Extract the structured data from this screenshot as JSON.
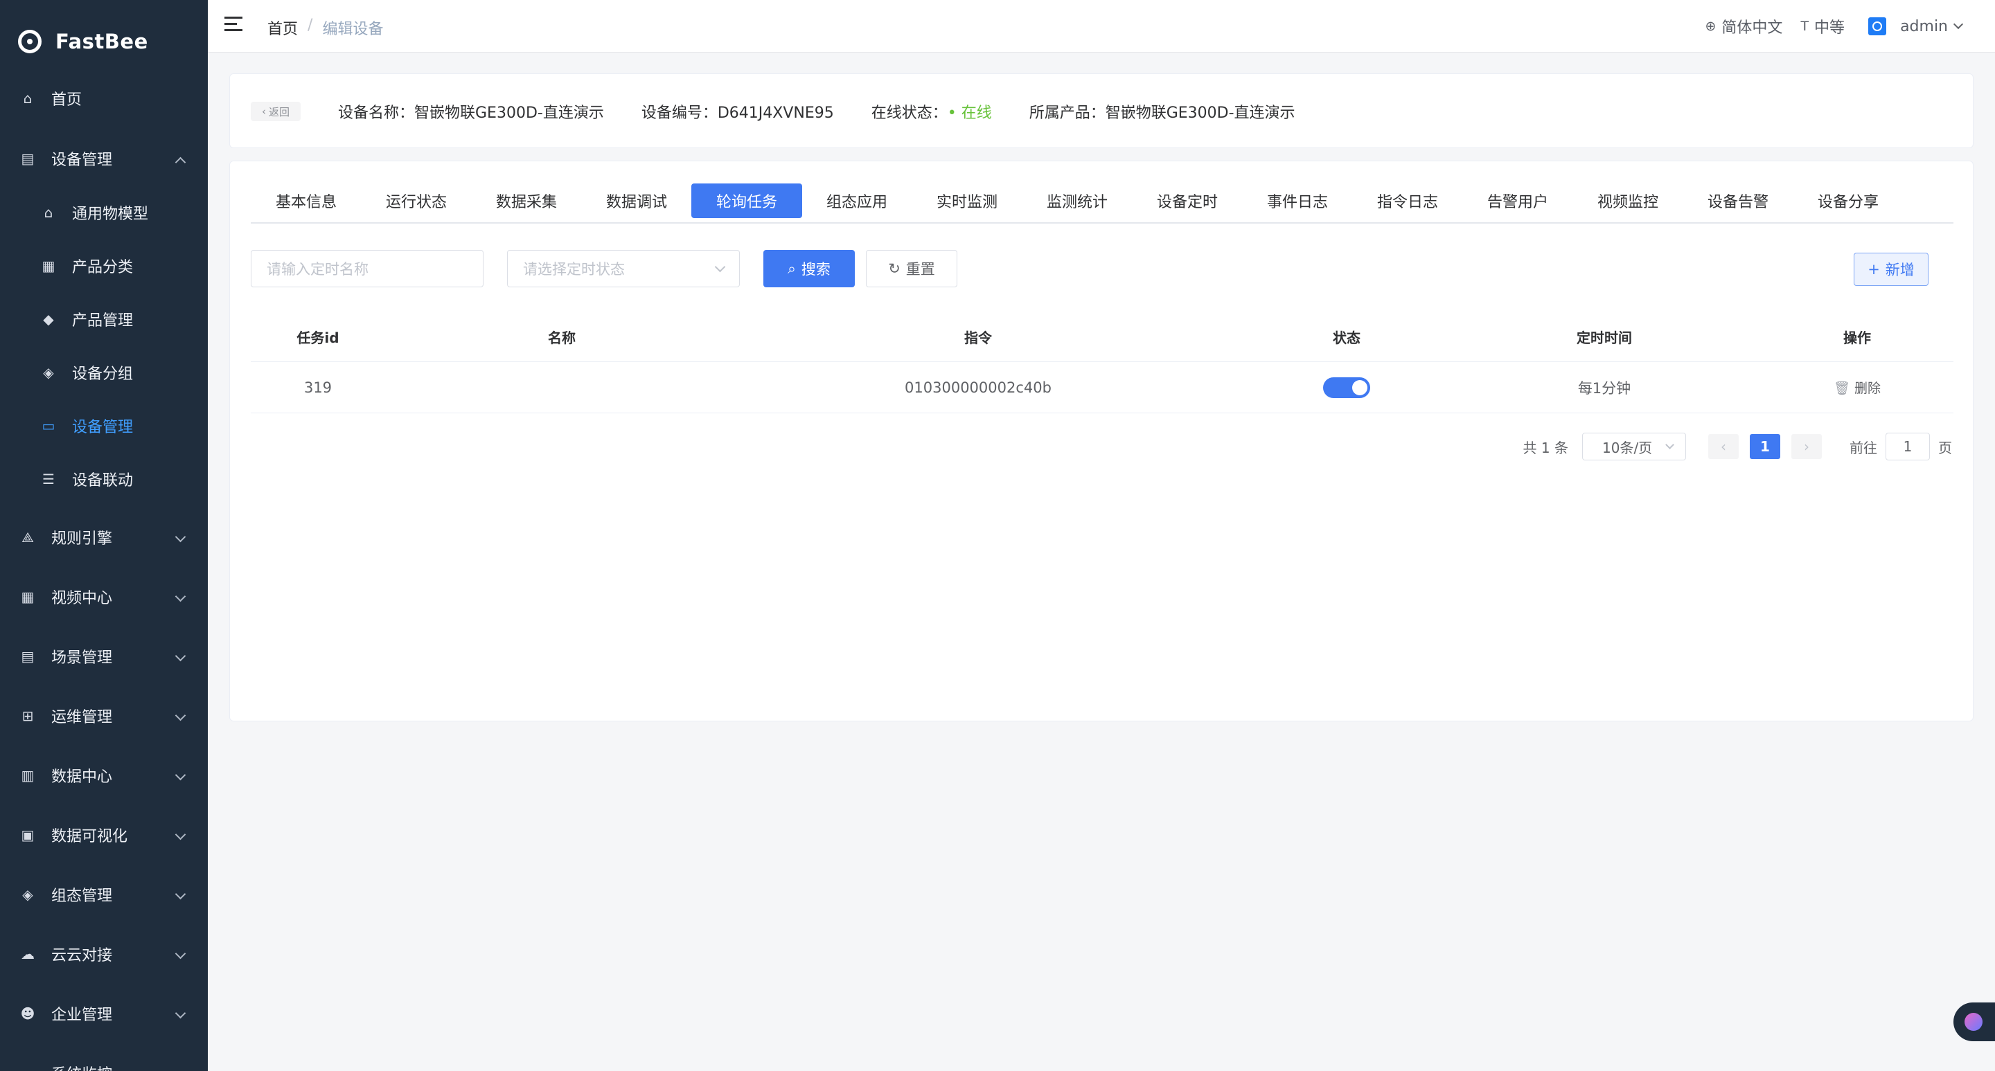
{
  "app": {
    "name": "FastBee"
  },
  "sidebar": {
    "items": [
      {
        "label": "首页",
        "icon": "home-icon",
        "glyph": "⌂"
      },
      {
        "label": "设备管理",
        "icon": "device-list-icon",
        "glyph": "▤",
        "expanded": true
      },
      {
        "label": "通用物模型",
        "icon": "model-icon",
        "glyph": "⌂"
      },
      {
        "label": "产品分类",
        "icon": "category-icon",
        "glyph": "▦"
      },
      {
        "label": "产品管理",
        "icon": "cube-icon",
        "glyph": "◆"
      },
      {
        "label": "设备分组",
        "icon": "layers-icon",
        "glyph": "◈"
      },
      {
        "label": "设备管理",
        "icon": "device-icon",
        "glyph": "▭",
        "active": true
      },
      {
        "label": "设备联动",
        "icon": "linkage-icon",
        "glyph": "☰"
      },
      {
        "label": "规则引擎",
        "icon": "rule-icon",
        "glyph": "⟁"
      },
      {
        "label": "视频中心",
        "icon": "video-icon",
        "glyph": "▦"
      },
      {
        "label": "场景管理",
        "icon": "scene-icon",
        "glyph": "▤"
      },
      {
        "label": "运维管理",
        "icon": "ops-icon",
        "glyph": "⊞"
      },
      {
        "label": "数据中心",
        "icon": "chart-icon",
        "glyph": "▥"
      },
      {
        "label": "数据可视化",
        "icon": "visual-icon",
        "glyph": "▣"
      },
      {
        "label": "组态管理",
        "icon": "config-icon",
        "glyph": "◈"
      },
      {
        "label": "云云对接",
        "icon": "cloud-icon",
        "glyph": "☁"
      },
      {
        "label": "企业管理",
        "icon": "enterprise-icon",
        "glyph": "☻"
      },
      {
        "label": "系统监控",
        "icon": "monitor-icon",
        "glyph": "▭"
      }
    ]
  },
  "header": {
    "breadcrumb": {
      "home": "首页",
      "separator": "/",
      "current": "编辑设备"
    },
    "language": "简体中文",
    "font_size": "中等",
    "user": "admin"
  },
  "device": {
    "back_label": "返回",
    "name": "设备名称：智嵌物联GE300D-直连演示",
    "serial": "设备编号：D641J4XVNE95",
    "status_label": "在线状态：",
    "status_value": "在线",
    "product": "所属产品：智嵌物联GE300D-直连演示"
  },
  "tabs": [
    "基本信息",
    "运行状态",
    "数据采集",
    "数据调试",
    "轮询任务",
    "组态应用",
    "实时监测",
    "监测统计",
    "设备定时",
    "事件日志",
    "指令日志",
    "告警用户",
    "视频监控",
    "设备告警",
    "设备分享"
  ],
  "active_tab": 4,
  "filters": {
    "name_placeholder": "请输入定时名称",
    "status_placeholder": "请选择定时状态",
    "search_label": "搜索",
    "reset_label": "重置",
    "add_label": "新增"
  },
  "table": {
    "columns": [
      "任务id",
      "名称",
      "指令",
      "状态",
      "定时时间",
      "操作"
    ],
    "rows": [
      {
        "id": "319",
        "name": "",
        "command": "010300000002c40b",
        "enabled": true,
        "schedule": "每1分钟",
        "action": "删除"
      }
    ]
  },
  "pagination": {
    "total": "共 1 条",
    "page_size": "10条/页",
    "current_page": "1",
    "goto_label": "前往",
    "goto_value": "1",
    "page_suffix": "页"
  },
  "colors": {
    "sidebar": "#1f2d3d",
    "primary": "#3f79f2",
    "online": "#67c23a"
  }
}
